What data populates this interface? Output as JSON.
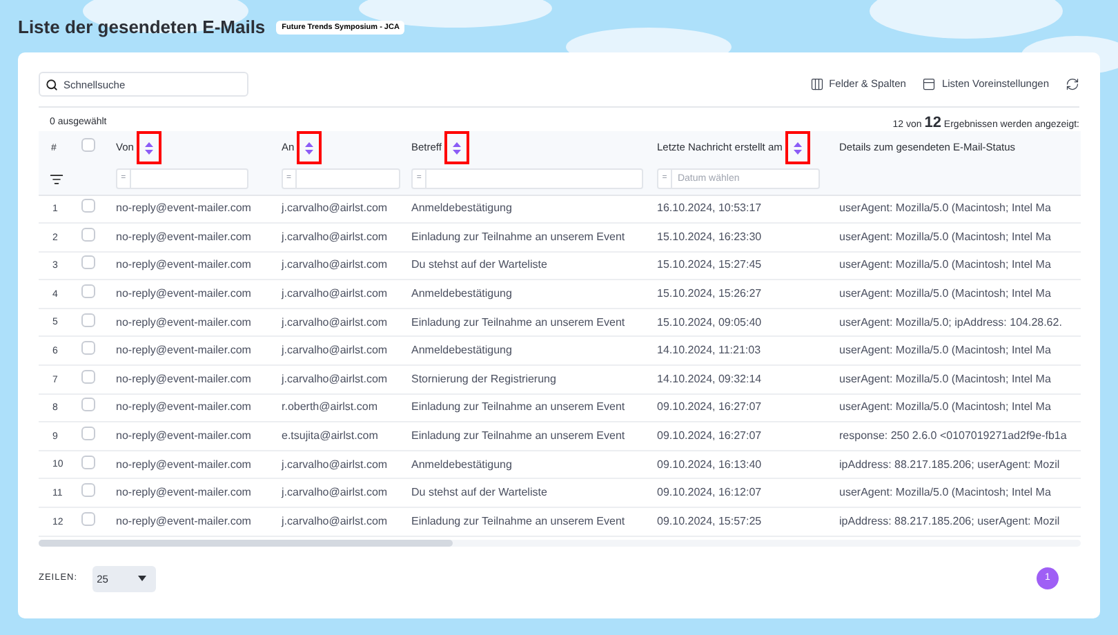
{
  "page": {
    "title": "Liste der gesendeten E-Mails",
    "badge": "Future Trends Symposium - JCA"
  },
  "toolbar": {
    "search": {
      "placeholder": "Schnellsuche"
    },
    "buttons": [
      {
        "kind": "columns",
        "label": "Felder & Spalten"
      },
      {
        "kind": "layout",
        "label": "Listen Voreinstellungen"
      },
      {
        "kind": "refresh"
      }
    ]
  },
  "selection": "0 ausgewählt",
  "results": "12 von **12** Ergebnissen werden angezeigt:",
  "table": {
    "columns": [
      {
        "kind": "number",
        "label": "#"
      },
      {
        "kind": "checkbox",
        "checked": false
      },
      {
        "kind": "text",
        "label": "Von",
        "sortable": true,
        "highlighted": true,
        "filter": {
          "operator": "="
        }
      },
      {
        "kind": "text",
        "label": "An",
        "sortable": true,
        "highlighted": true,
        "filter": {
          "operator": "="
        }
      },
      {
        "kind": "text",
        "label": "Betreff",
        "sortable": true,
        "highlighted": true,
        "filter": {
          "operator": "="
        }
      },
      {
        "kind": "text",
        "label": "Letzte Nachricht erstellt am",
        "sortable": true,
        "highlighted": true,
        "filter": {
          "operator": "=",
          "placeholder": "Datum wählen"
        }
      },
      {
        "kind": "text",
        "label": "Details zum gesendeten E-Mail-Status",
        "sortable": false,
        "highlighted": false
      }
    ],
    "rows": [
      {
        "number": "1",
        "checked": false,
        "from": "no-reply@event-mailer.com",
        "to": "j.carvalho@airlst.com",
        "subject": "Anmeldebestätigung",
        "date": "16.10.2024, 10:53:17",
        "details": "userAgent: Mozilla/5.0 (Macintosh; Intel Ma"
      },
      {
        "number": "2",
        "checked": false,
        "from": "no-reply@event-mailer.com",
        "to": "j.carvalho@airlst.com",
        "subject": "Einladung zur Teilnahme an unserem Event",
        "date": "15.10.2024, 16:23:30",
        "details": "userAgent: Mozilla/5.0 (Macintosh; Intel Ma"
      },
      {
        "number": "3",
        "checked": false,
        "from": "no-reply@event-mailer.com",
        "to": "j.carvalho@airlst.com",
        "subject": "Du stehst auf der Warteliste",
        "date": "15.10.2024, 15:27:45",
        "details": "userAgent: Mozilla/5.0 (Macintosh; Intel Ma"
      },
      {
        "number": "4",
        "checked": false,
        "from": "no-reply@event-mailer.com",
        "to": "j.carvalho@airlst.com",
        "subject": "Anmeldebestätigung",
        "date": "15.10.2024, 15:26:27",
        "details": "userAgent: Mozilla/5.0 (Macintosh; Intel Ma"
      },
      {
        "number": "5",
        "checked": false,
        "from": "no-reply@event-mailer.com",
        "to": "j.carvalho@airlst.com",
        "subject": "Einladung zur Teilnahme an unserem Event",
        "date": "15.10.2024, 09:05:40",
        "details": "userAgent: Mozilla/5.0; ipAddress: 104.28.62."
      },
      {
        "number": "6",
        "checked": false,
        "from": "no-reply@event-mailer.com",
        "to": "j.carvalho@airlst.com",
        "subject": "Anmeldebestätigung",
        "date": "14.10.2024, 11:21:03",
        "details": "userAgent: Mozilla/5.0 (Macintosh; Intel Ma"
      },
      {
        "number": "7",
        "checked": false,
        "from": "no-reply@event-mailer.com",
        "to": "j.carvalho@airlst.com",
        "subject": "Stornierung der Registrierung",
        "date": "14.10.2024, 09:32:14",
        "details": "userAgent: Mozilla/5.0 (Macintosh; Intel Ma"
      },
      {
        "number": "8",
        "checked": false,
        "from": "no-reply@event-mailer.com",
        "to": "r.oberth@airlst.com",
        "subject": "Einladung zur Teilnahme an unserem Event",
        "date": "09.10.2024, 16:27:07",
        "details": "userAgent: Mozilla/5.0 (Macintosh; Intel Ma"
      },
      {
        "number": "9",
        "checked": false,
        "from": "no-reply@event-mailer.com",
        "to": "e.tsujita@airlst.com",
        "subject": "Einladung zur Teilnahme an unserem Event",
        "date": "09.10.2024, 16:27:07",
        "details": "response: 250 2.6.0 <0107019271ad2f9e-fb1a"
      },
      {
        "number": "10",
        "checked": false,
        "from": "no-reply@event-mailer.com",
        "to": "j.carvalho@airlst.com",
        "subject": "Anmeldebestätigung",
        "date": "09.10.2024, 16:13:40",
        "details": "ipAddress: 88.217.185.206; userAgent: Mozil"
      },
      {
        "number": "11",
        "checked": false,
        "from": "no-reply@event-mailer.com",
        "to": "j.carvalho@airlst.com",
        "subject": "Du stehst auf der Warteliste",
        "date": "09.10.2024, 16:12:07",
        "details": "userAgent: Mozilla/5.0 (Macintosh; Intel Ma"
      },
      {
        "number": "12",
        "checked": false,
        "from": "no-reply@event-mailer.com",
        "to": "j.carvalho@airlst.com",
        "subject": "Einladung zur Teilnahme an unserem Event",
        "date": "09.10.2024, 15:57:25",
        "details": "ipAddress: 88.217.185.206; userAgent: Mozil"
      }
    ]
  },
  "footer": {
    "rows_label": "ZEILEN:",
    "rows_per_page": "25",
    "pages": [
      {
        "label": "1",
        "selected": true
      }
    ]
  }
}
